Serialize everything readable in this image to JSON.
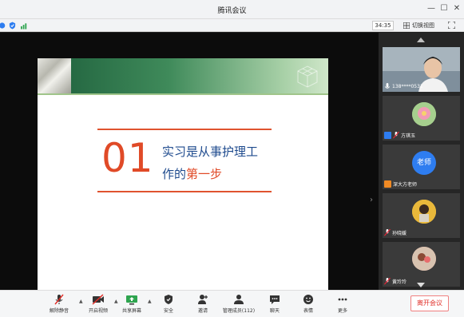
{
  "window": {
    "title": "腾讯会议"
  },
  "infobar": {
    "timer": "34:35",
    "switch_view_label": "切换视图"
  },
  "slide": {
    "number": "01",
    "line1": "实习是从事护理工",
    "line2_prefix": "作的",
    "line2_highlight": "第一步"
  },
  "participants": [
    {
      "name": "138****0531"
    },
    {
      "name": "方琪玉"
    },
    {
      "name": "深大方老师",
      "avatar_text": "老师"
    },
    {
      "name": "孙晓媛"
    },
    {
      "name": "黄玲玲"
    }
  ],
  "toolbar": {
    "mute": "解除静音",
    "video": "开启视频",
    "share": "共享屏幕",
    "security": "安全",
    "invite": "邀请",
    "members": "管理成员(112)",
    "chat": "聊天",
    "reactions": "表情",
    "more": "更多",
    "leave": "离开会议"
  },
  "colors": {
    "accent_red": "#e04a27",
    "slide_blue": "#1f4b8e",
    "leave_red": "#e0302a"
  }
}
